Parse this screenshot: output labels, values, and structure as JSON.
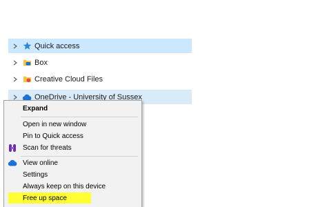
{
  "nav": {
    "items": [
      {
        "label": "Quick access",
        "icon": "star-icon",
        "state": "selected"
      },
      {
        "label": "Box",
        "icon": "box-folder-icon",
        "state": "normal"
      },
      {
        "label": "Creative Cloud Files",
        "icon": "creative-cloud-folder-icon",
        "state": "normal"
      },
      {
        "label": "OneDrive - University of Sussex",
        "icon": "onedrive-cloud-icon",
        "state": "hover"
      }
    ]
  },
  "context_menu": {
    "items": [
      {
        "label": "Expand",
        "bold": true
      },
      {
        "label": "Open in new window"
      },
      {
        "label": "Pin to Quick access"
      },
      {
        "label": "Scan for threats",
        "icon": "antivirus-scan-icon"
      },
      {
        "label": "View online",
        "icon": "onedrive-cloud-icon"
      },
      {
        "label": "Settings"
      },
      {
        "label": "Always keep on this device"
      },
      {
        "label": "Free up space",
        "highlighted": true
      }
    ]
  },
  "colors": {
    "selected_background": "#cce8ff",
    "hover_background": "#d9ebf9",
    "highlight": "#ffff33",
    "menu_background": "#f2f2f2"
  }
}
